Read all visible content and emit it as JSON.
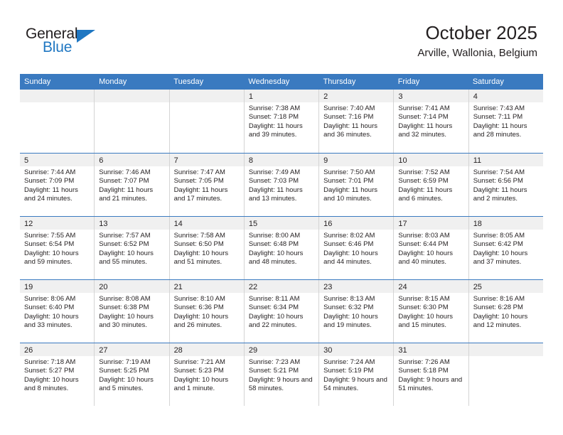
{
  "logo": {
    "primary_text": "General",
    "secondary_text": "Blue",
    "triangle_icon": "triangle-icon",
    "accent_color": "#1f77c2"
  },
  "header": {
    "title": "October 2025",
    "subtitle": "Arville, Wallonia, Belgium"
  },
  "colors": {
    "header_blue": "#3a7ac0",
    "daynum_band": "#f0f0f0",
    "cell_border": "#d4d4d4",
    "text": "#231f20"
  },
  "weekdays": [
    "Sunday",
    "Monday",
    "Tuesday",
    "Wednesday",
    "Thursday",
    "Friday",
    "Saturday"
  ],
  "weeks": [
    [
      {
        "day": "",
        "sunrise": "",
        "sunset": "",
        "daylight": "",
        "empty": true
      },
      {
        "day": "",
        "sunrise": "",
        "sunset": "",
        "daylight": "",
        "empty": true
      },
      {
        "day": "",
        "sunrise": "",
        "sunset": "",
        "daylight": "",
        "empty": true
      },
      {
        "day": "1",
        "sunrise": "Sunrise: 7:38 AM",
        "sunset": "Sunset: 7:18 PM",
        "daylight": "Daylight: 11 hours and 39 minutes."
      },
      {
        "day": "2",
        "sunrise": "Sunrise: 7:40 AM",
        "sunset": "Sunset: 7:16 PM",
        "daylight": "Daylight: 11 hours and 36 minutes."
      },
      {
        "day": "3",
        "sunrise": "Sunrise: 7:41 AM",
        "sunset": "Sunset: 7:14 PM",
        "daylight": "Daylight: 11 hours and 32 minutes."
      },
      {
        "day": "4",
        "sunrise": "Sunrise: 7:43 AM",
        "sunset": "Sunset: 7:11 PM",
        "daylight": "Daylight: 11 hours and 28 minutes."
      }
    ],
    [
      {
        "day": "5",
        "sunrise": "Sunrise: 7:44 AM",
        "sunset": "Sunset: 7:09 PM",
        "daylight": "Daylight: 11 hours and 24 minutes."
      },
      {
        "day": "6",
        "sunrise": "Sunrise: 7:46 AM",
        "sunset": "Sunset: 7:07 PM",
        "daylight": "Daylight: 11 hours and 21 minutes."
      },
      {
        "day": "7",
        "sunrise": "Sunrise: 7:47 AM",
        "sunset": "Sunset: 7:05 PM",
        "daylight": "Daylight: 11 hours and 17 minutes."
      },
      {
        "day": "8",
        "sunrise": "Sunrise: 7:49 AM",
        "sunset": "Sunset: 7:03 PM",
        "daylight": "Daylight: 11 hours and 13 minutes."
      },
      {
        "day": "9",
        "sunrise": "Sunrise: 7:50 AM",
        "sunset": "Sunset: 7:01 PM",
        "daylight": "Daylight: 11 hours and 10 minutes."
      },
      {
        "day": "10",
        "sunrise": "Sunrise: 7:52 AM",
        "sunset": "Sunset: 6:59 PM",
        "daylight": "Daylight: 11 hours and 6 minutes."
      },
      {
        "day": "11",
        "sunrise": "Sunrise: 7:54 AM",
        "sunset": "Sunset: 6:56 PM",
        "daylight": "Daylight: 11 hours and 2 minutes."
      }
    ],
    [
      {
        "day": "12",
        "sunrise": "Sunrise: 7:55 AM",
        "sunset": "Sunset: 6:54 PM",
        "daylight": "Daylight: 10 hours and 59 minutes."
      },
      {
        "day": "13",
        "sunrise": "Sunrise: 7:57 AM",
        "sunset": "Sunset: 6:52 PM",
        "daylight": "Daylight: 10 hours and 55 minutes."
      },
      {
        "day": "14",
        "sunrise": "Sunrise: 7:58 AM",
        "sunset": "Sunset: 6:50 PM",
        "daylight": "Daylight: 10 hours and 51 minutes."
      },
      {
        "day": "15",
        "sunrise": "Sunrise: 8:00 AM",
        "sunset": "Sunset: 6:48 PM",
        "daylight": "Daylight: 10 hours and 48 minutes."
      },
      {
        "day": "16",
        "sunrise": "Sunrise: 8:02 AM",
        "sunset": "Sunset: 6:46 PM",
        "daylight": "Daylight: 10 hours and 44 minutes."
      },
      {
        "day": "17",
        "sunrise": "Sunrise: 8:03 AM",
        "sunset": "Sunset: 6:44 PM",
        "daylight": "Daylight: 10 hours and 40 minutes."
      },
      {
        "day": "18",
        "sunrise": "Sunrise: 8:05 AM",
        "sunset": "Sunset: 6:42 PM",
        "daylight": "Daylight: 10 hours and 37 minutes."
      }
    ],
    [
      {
        "day": "19",
        "sunrise": "Sunrise: 8:06 AM",
        "sunset": "Sunset: 6:40 PM",
        "daylight": "Daylight: 10 hours and 33 minutes."
      },
      {
        "day": "20",
        "sunrise": "Sunrise: 8:08 AM",
        "sunset": "Sunset: 6:38 PM",
        "daylight": "Daylight: 10 hours and 30 minutes."
      },
      {
        "day": "21",
        "sunrise": "Sunrise: 8:10 AM",
        "sunset": "Sunset: 6:36 PM",
        "daylight": "Daylight: 10 hours and 26 minutes."
      },
      {
        "day": "22",
        "sunrise": "Sunrise: 8:11 AM",
        "sunset": "Sunset: 6:34 PM",
        "daylight": "Daylight: 10 hours and 22 minutes."
      },
      {
        "day": "23",
        "sunrise": "Sunrise: 8:13 AM",
        "sunset": "Sunset: 6:32 PM",
        "daylight": "Daylight: 10 hours and 19 minutes."
      },
      {
        "day": "24",
        "sunrise": "Sunrise: 8:15 AM",
        "sunset": "Sunset: 6:30 PM",
        "daylight": "Daylight: 10 hours and 15 minutes."
      },
      {
        "day": "25",
        "sunrise": "Sunrise: 8:16 AM",
        "sunset": "Sunset: 6:28 PM",
        "daylight": "Daylight: 10 hours and 12 minutes."
      }
    ],
    [
      {
        "day": "26",
        "sunrise": "Sunrise: 7:18 AM",
        "sunset": "Sunset: 5:27 PM",
        "daylight": "Daylight: 10 hours and 8 minutes."
      },
      {
        "day": "27",
        "sunrise": "Sunrise: 7:19 AM",
        "sunset": "Sunset: 5:25 PM",
        "daylight": "Daylight: 10 hours and 5 minutes."
      },
      {
        "day": "28",
        "sunrise": "Sunrise: 7:21 AM",
        "sunset": "Sunset: 5:23 PM",
        "daylight": "Daylight: 10 hours and 1 minute."
      },
      {
        "day": "29",
        "sunrise": "Sunrise: 7:23 AM",
        "sunset": "Sunset: 5:21 PM",
        "daylight": "Daylight: 9 hours and 58 minutes."
      },
      {
        "day": "30",
        "sunrise": "Sunrise: 7:24 AM",
        "sunset": "Sunset: 5:19 PM",
        "daylight": "Daylight: 9 hours and 54 minutes."
      },
      {
        "day": "31",
        "sunrise": "Sunrise: 7:26 AM",
        "sunset": "Sunset: 5:18 PM",
        "daylight": "Daylight: 9 hours and 51 minutes."
      },
      {
        "day": "",
        "sunrise": "",
        "sunset": "",
        "daylight": "",
        "empty": true
      }
    ]
  ]
}
